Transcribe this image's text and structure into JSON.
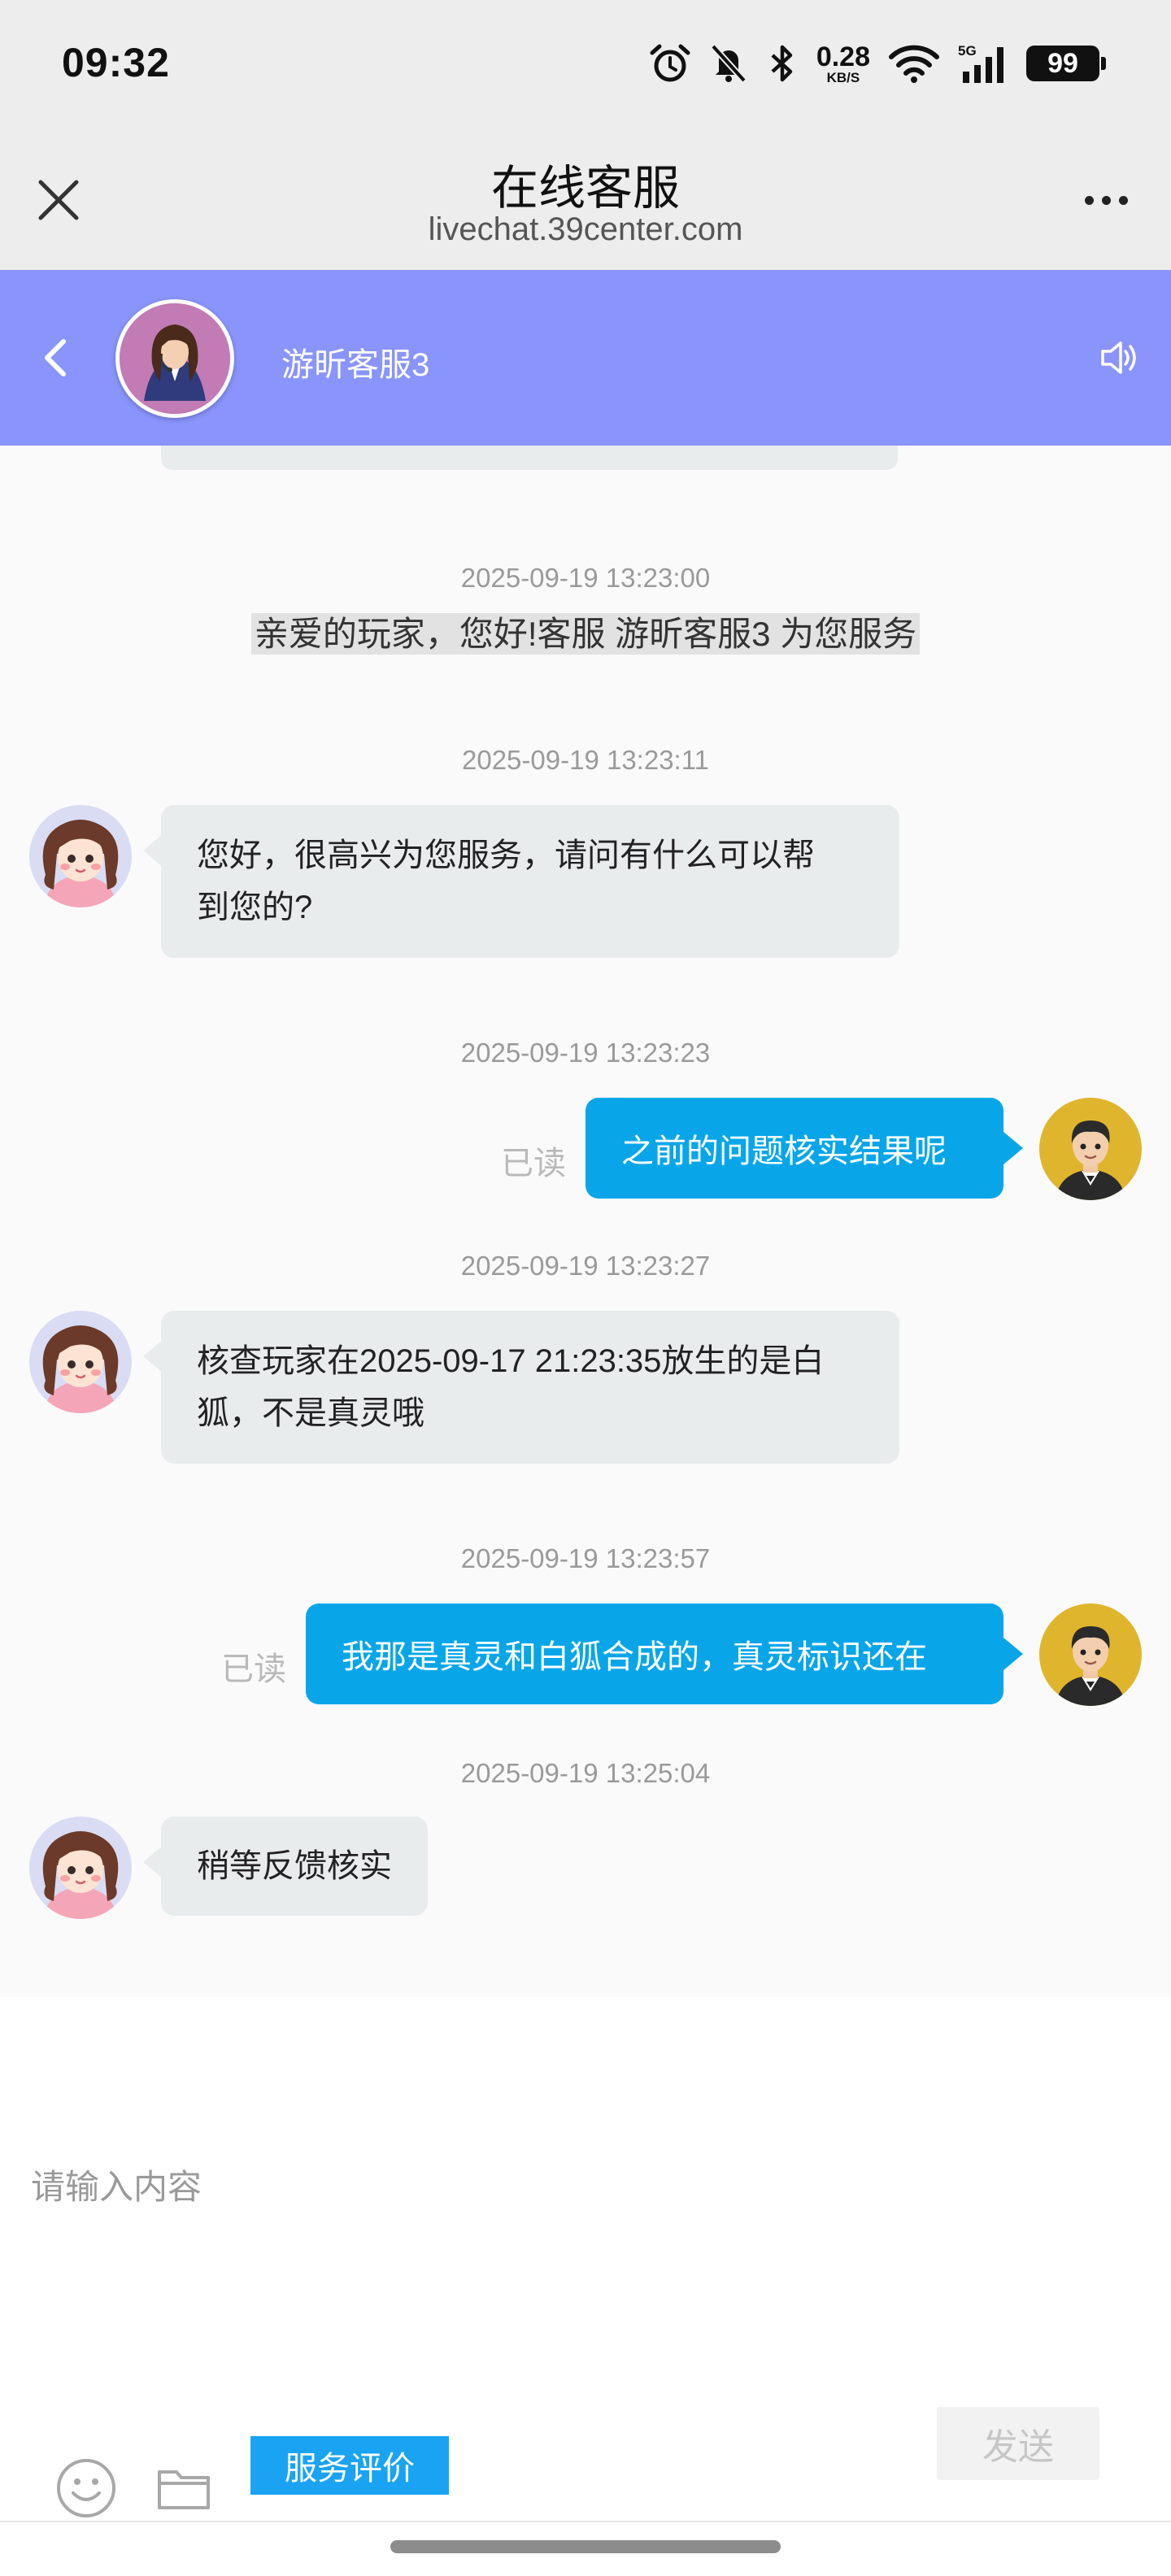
{
  "status_bar": {
    "time": "09:32",
    "net_speed_value": "0.28",
    "net_speed_unit": "KB/S",
    "network_type": "5G",
    "battery": "99",
    "icons": [
      "alarm-icon",
      "mute-bell-icon",
      "bluetooth-icon",
      "wifi-icon",
      "signal-icon",
      "battery-icon"
    ]
  },
  "title_bar": {
    "title": "在线客服",
    "url": "livechat.39center.com"
  },
  "agent_header": {
    "name": "游昕客服3",
    "accent_color": "#8a94fd"
  },
  "messages": [
    {
      "timestamp": "2025-09-19 13:23:00",
      "type": "system",
      "text": "亲爱的玩家，您好!客服 游昕客服3 为您服务"
    },
    {
      "timestamp": "2025-09-19 13:23:11",
      "type": "incoming",
      "lines": [
        "您好，很高兴为您服务，请问有什么可以帮",
        "到您的?"
      ]
    },
    {
      "timestamp": "2025-09-19 13:23:23",
      "type": "outgoing",
      "text": "之前的问题核实结果呢",
      "status": "已读"
    },
    {
      "timestamp": "2025-09-19 13:23:27",
      "type": "incoming",
      "lines": [
        "核查玩家在2025-09-17 21:23:35放生的是白",
        "狐，不是真灵哦"
      ]
    },
    {
      "timestamp": "2025-09-19 13:23:57",
      "type": "outgoing",
      "text": "我那是真灵和白狐合成的，真灵标识还在",
      "status": "已读"
    },
    {
      "timestamp": "2025-09-19 13:25:04",
      "type": "incoming",
      "lines": [
        "稍等反馈核实"
      ]
    }
  ],
  "composer": {
    "placeholder": "请输入内容",
    "send_label": "发送",
    "rate_label": "服务评价",
    "outgoing_color": "#08a6e9",
    "rate_color": "#1aa3f3"
  }
}
